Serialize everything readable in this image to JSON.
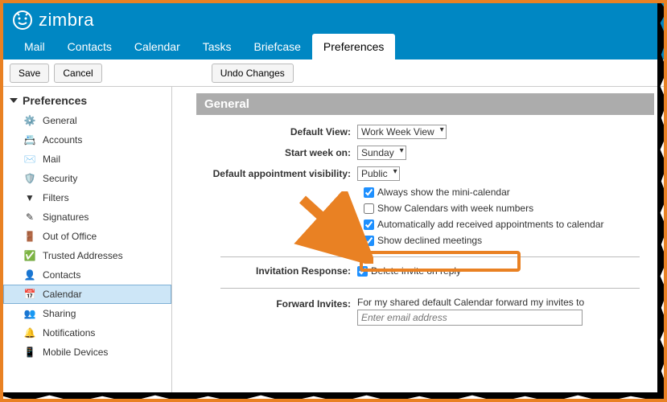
{
  "brand": "zimbra",
  "nav": {
    "tabs": [
      "Mail",
      "Contacts",
      "Calendar",
      "Tasks",
      "Briefcase",
      "Preferences"
    ],
    "active": "Preferences"
  },
  "toolbar": {
    "save": "Save",
    "cancel": "Cancel",
    "undo": "Undo Changes"
  },
  "sidebar": {
    "title": "Preferences",
    "items": [
      "General",
      "Accounts",
      "Mail",
      "Security",
      "Filters",
      "Signatures",
      "Out of Office",
      "Trusted Addresses",
      "Contacts",
      "Calendar",
      "Sharing",
      "Notifications",
      "Mobile Devices"
    ],
    "selected": "Calendar"
  },
  "section": {
    "title": "General"
  },
  "form": {
    "default_view_label": "Default View:",
    "default_view_value": "Work Week View",
    "start_week_label": "Start week on:",
    "start_week_value": "Sunday",
    "visibility_label": "Default appointment visibility:",
    "visibility_value": "Public",
    "cb_mini": "Always show the mini-calendar",
    "cb_weeknum": "Show Calendars with week numbers",
    "cb_autoadd": "Automatically add received appointments to calendar",
    "cb_declined": "Show declined meetings",
    "inv_label": "Invitation Response:",
    "inv_delete": "Delete invite on reply",
    "fwd_label": "Forward Invites:",
    "fwd_text": "For my shared default Calendar forward my invites to",
    "fwd_placeholder": "Enter email address"
  }
}
